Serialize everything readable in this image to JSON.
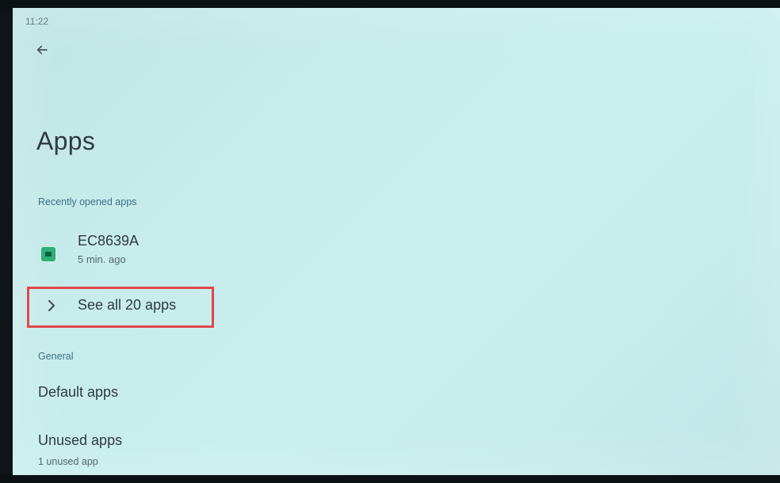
{
  "status_bar": {
    "time": "11:22"
  },
  "header": {
    "back_icon": "arrow-left-icon",
    "title": "Apps"
  },
  "recent_section": {
    "label": "Recently opened apps",
    "apps": [
      {
        "name": "EC8639A",
        "time": "5 min. ago",
        "icon": "app-icon"
      }
    ]
  },
  "see_all": {
    "label": "See all 20 apps",
    "icon": "chevron-right-icon",
    "highlight_color": "#e3474d"
  },
  "general_section": {
    "label": "General",
    "default_apps": "Default apps",
    "unused_apps": {
      "title": "Unused apps",
      "subtitle": "1 unused app"
    }
  },
  "colors": {
    "accent_label": "#3d6f8b",
    "app_icon": "#2fae77"
  }
}
